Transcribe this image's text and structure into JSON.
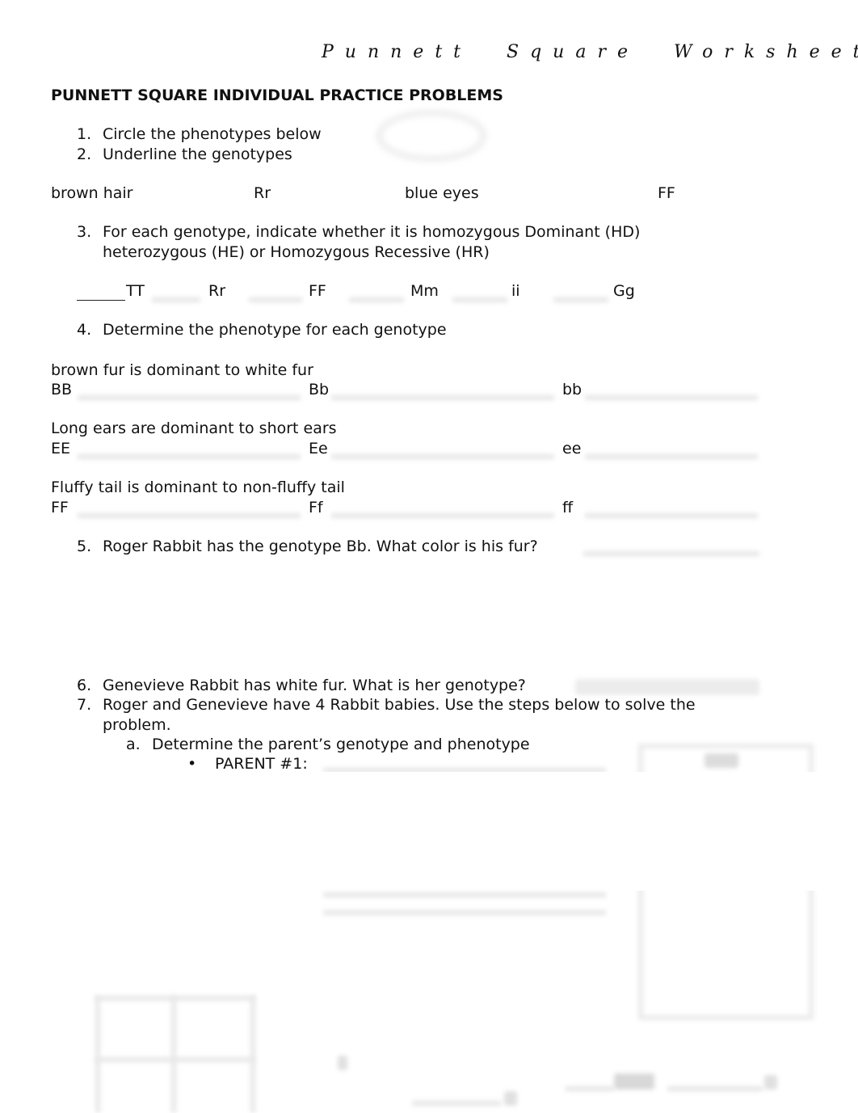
{
  "header": {
    "title": "Punnett Square Worksheet"
  },
  "section_title": "PUNNETT SQUARE INDIVIDUAL PRACTICE PROBLEMS",
  "q1": {
    "num": "1.",
    "text": "Circle the phenotypes below"
  },
  "q2": {
    "num": "2.",
    "text": "Underline the genotypes"
  },
  "q12_items": [
    "brown hair",
    "Rr",
    "blue eyes",
    "FF"
  ],
  "q3": {
    "num": "3.",
    "line1": "For each genotype, indicate whether it is homozygous Dominant (HD)",
    "line2": "heterozygous (HE) or Homozygous Recessive (HR)",
    "genotypes": [
      "TT",
      "Rr",
      "FF",
      "Mm",
      "ii",
      "Gg"
    ]
  },
  "q4": {
    "num": "4.",
    "text": "Determine the phenotype for each genotype",
    "groups": [
      {
        "rule": "brown fur is dominant to white fur",
        "genotypes": [
          "BB",
          "Bb",
          "bb"
        ]
      },
      {
        "rule": "Long ears are dominant to short ears",
        "genotypes": [
          "EE",
          "Ee",
          "ee"
        ]
      },
      {
        "rule": "Fluffy tail is dominant to non-fluffy tail",
        "genotypes": [
          "FF",
          "Ff",
          "ff"
        ]
      }
    ]
  },
  "q5": {
    "num": "5.",
    "text": "Roger Rabbit has the genotype Bb. What color is his fur?"
  },
  "q6": {
    "num": "6.",
    "text": "Genevieve Rabbit has white fur. What is her genotype?"
  },
  "q7": {
    "num": "7.",
    "line1": "Roger and Genevieve have 4 Rabbit babies. Use the steps below to solve the",
    "line2": "problem.",
    "sub_a": {
      "label": "a.",
      "text": "Determine the parent’s genotype and phenotype"
    },
    "bullet": {
      "symbol": "•",
      "text": "PARENT #1:"
    }
  }
}
